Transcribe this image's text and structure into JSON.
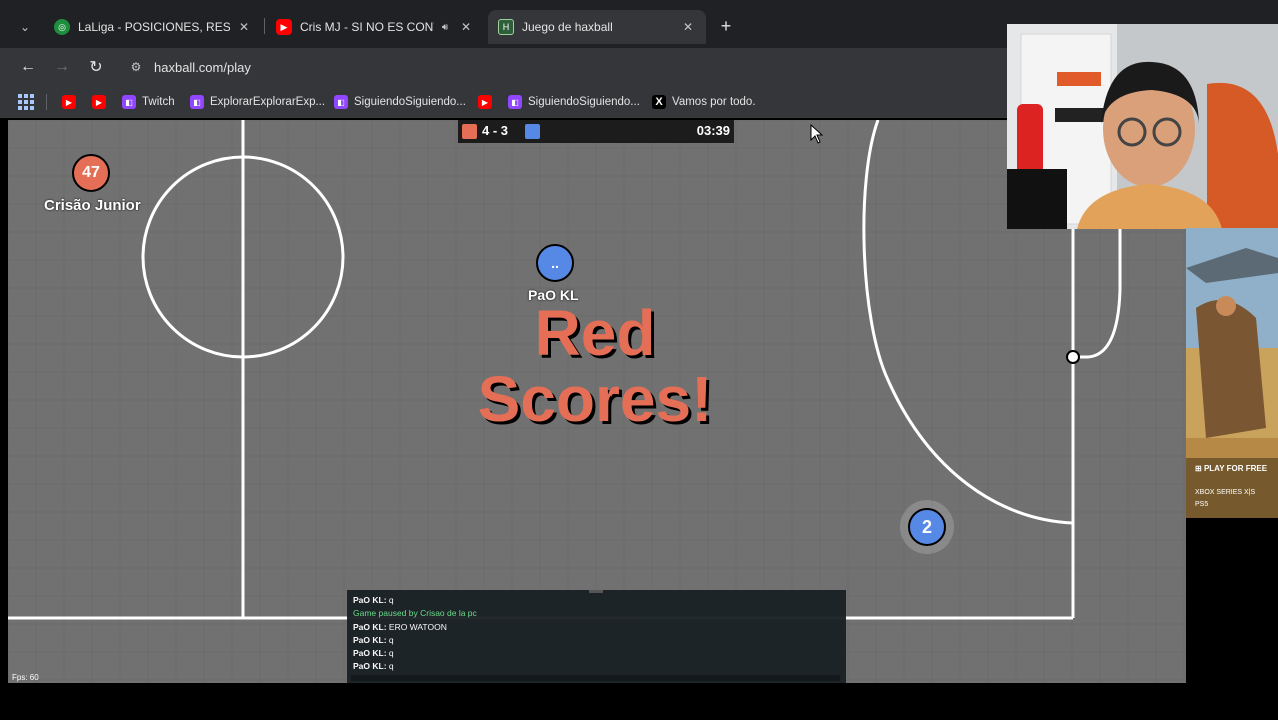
{
  "browser": {
    "tabs": [
      {
        "title": "LaLiga - POSICIONES, RESULTA",
        "favicon": "globe-icon",
        "active": false
      },
      {
        "title": "Cris MJ - SI NO ES CONTIGO",
        "favicon": "youtube-icon",
        "active": false,
        "audio": true
      },
      {
        "title": "Juego de haxball",
        "favicon": "haxball-icon",
        "active": true
      }
    ],
    "url": "haxball.com/play",
    "bookmarks": [
      {
        "label": "",
        "icon": "youtube-icon"
      },
      {
        "label": "",
        "icon": "youtube-icon"
      },
      {
        "label": "Twitch",
        "icon": "twitch-icon"
      },
      {
        "label": "ExplorarExplorarExp...",
        "icon": "twitch-icon"
      },
      {
        "label": "SiguiendoSiguiendo...",
        "icon": "twitch-icon"
      },
      {
        "label": "",
        "icon": "youtube-icon"
      },
      {
        "label": "SiguiendoSiguiendo...",
        "icon": "twitch-icon"
      },
      {
        "label": "Vamos por todo.",
        "icon": "x-icon"
      }
    ]
  },
  "game": {
    "score": "4 - 3",
    "time": "03:39",
    "banner_line1": "Red",
    "banner_line2": "Scores!",
    "players": [
      {
        "team": "red",
        "avatar": "47",
        "name": "Crisão Junior"
      },
      {
        "team": "blue",
        "avatar": "..",
        "name": "PaO KL"
      },
      {
        "team": "blue",
        "avatar": "2",
        "name": ""
      }
    ],
    "chat": [
      {
        "author": "PaO KL:",
        "text": "q",
        "system": false
      },
      {
        "author": "",
        "text": "Game paused by Crisao de la pc",
        "system": true
      },
      {
        "author": "PaO KL:",
        "text": "ERO WATOON",
        "system": false
      },
      {
        "author": "PaO KL:",
        "text": "q",
        "system": false
      },
      {
        "author": "PaO KL:",
        "text": "q",
        "system": false
      },
      {
        "author": "PaO KL:",
        "text": "q",
        "system": false
      }
    ],
    "fps": "Fps: 60",
    "colors": {
      "red": "#e56e56",
      "blue": "#5689e5",
      "field": "#717171"
    }
  },
  "ad": {
    "cta": "PLAY FOR FREE",
    "platform1": "XBOX SERIES X|S",
    "platform2": "PS5"
  }
}
